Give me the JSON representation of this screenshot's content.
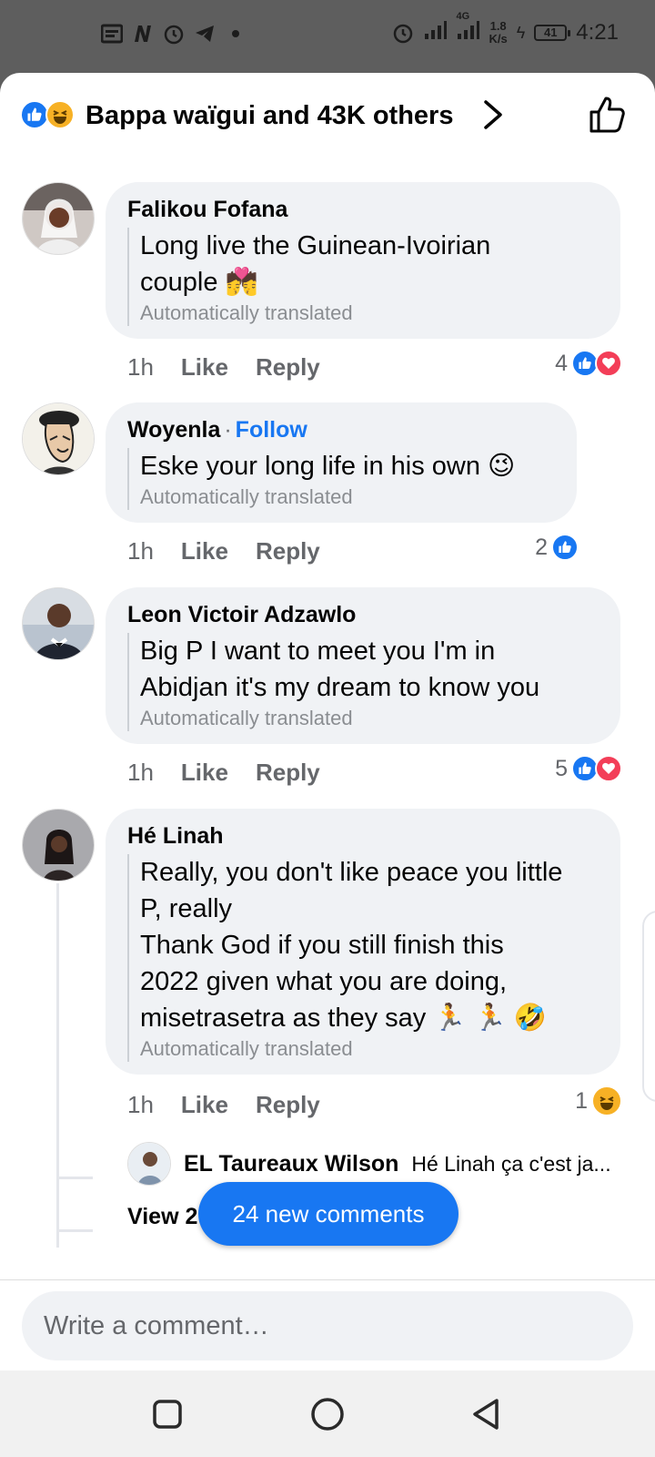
{
  "status_bar": {
    "left_icons": [
      "notification-list-icon",
      "n-app-icon",
      "alarm-icon",
      "telegram-icon",
      "dot-icon"
    ],
    "network": "4G",
    "speed_value": "1.8",
    "speed_unit": "K/s",
    "battery": "41",
    "time": "4:21"
  },
  "header": {
    "reactions": [
      "like",
      "haha"
    ],
    "summary": "Bappa waïgui and 43K others"
  },
  "comments": [
    {
      "author": "Falikou Fofana",
      "text": "Long live the Guinean-Ivoirian\ncouple 💏",
      "translated_label": "Automatically translated",
      "time": "1h",
      "like_label": "Like",
      "reply_label": "Reply",
      "reaction_count": "4",
      "reactions": [
        "like",
        "love"
      ]
    },
    {
      "author": "Woyenla",
      "follow_label": "Follow",
      "text": "Eske your long life in his own 😉",
      "translated_label": "Automatically translated",
      "time": "1h",
      "like_label": "Like",
      "reply_label": "Reply",
      "reaction_count": "2",
      "reactions": [
        "like"
      ]
    },
    {
      "author": "Leon Victoir Adzawlo",
      "text": "Big P I want to meet you I'm in\nAbidjan it's my dream to know you",
      "translated_label": "Automatically translated",
      "time": "1h",
      "like_label": "Like",
      "reply_label": "Reply",
      "reaction_count": "5",
      "reactions": [
        "like",
        "love"
      ]
    },
    {
      "author": "Hé Linah",
      "text": "Really, you don't like peace you little\nP, really\nThank God if you still finish this\n2022 given what you are doing,\nmisetrasetra as they say 🏃 🏃 🤣",
      "translated_label": "Automatically translated",
      "time": "1h",
      "like_label": "Like",
      "reply_label": "Reply",
      "reaction_count": "1",
      "reactions": [
        "haha"
      ],
      "reply_preview": {
        "author": "EL Taureaux Wilson",
        "snippet": "Hé Linah ça c'est ja..."
      },
      "view_more": "View 2"
    }
  ],
  "new_comments_pill": "24 new comments",
  "composer": {
    "placeholder": "Write a comment…"
  },
  "colors": {
    "accent": "#1877f2",
    "bubble": "#f0f2f5",
    "love": "#f33e58",
    "haha": "#f7b125"
  }
}
